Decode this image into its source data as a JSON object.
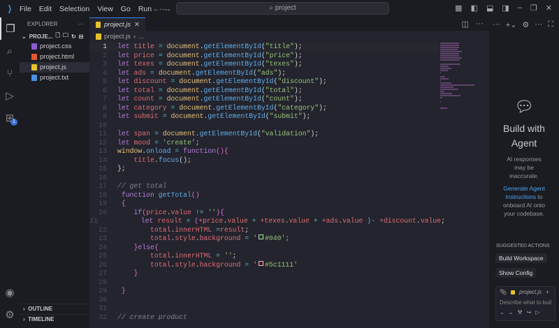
{
  "titlebar": {
    "menu": [
      "File",
      "Edit",
      "Selection",
      "View",
      "Go",
      "Run",
      "···"
    ],
    "search": "project"
  },
  "sidebar": {
    "title": "EXPLORER",
    "project": "PROJE...",
    "files": [
      {
        "name": "project.css",
        "color": "#8a5cd1"
      },
      {
        "name": "project.html",
        "color": "#e4572e"
      },
      {
        "name": "project.js",
        "color": "#e8c22b"
      },
      {
        "name": "project.txt",
        "color": "#4a8fe0"
      }
    ],
    "outline": "OUTLINE",
    "timeline": "TIMELINE",
    "extensions_badge": "1"
  },
  "editor": {
    "tab": "project.js",
    "breadcrumb": "project.js",
    "breadcrumb_more": "...",
    "current_line": 1,
    "lines": [
      [
        [
          "let ",
          "kw"
        ],
        [
          "title",
          "var"
        ],
        [
          " = ",
          "op"
        ],
        [
          "document",
          "obj"
        ],
        [
          ".",
          "p"
        ],
        [
          "getElementById",
          "fn"
        ],
        [
          "(",
          "p"
        ],
        [
          "\"title\"",
          "str"
        ],
        [
          ");",
          "p"
        ]
      ],
      [
        [
          "let ",
          "kw"
        ],
        [
          "price",
          "var"
        ],
        [
          " = ",
          "op"
        ],
        [
          "document",
          "obj"
        ],
        [
          ".",
          "p"
        ],
        [
          "getElementById",
          "fn"
        ],
        [
          "(",
          "p"
        ],
        [
          "\"price\"",
          "str"
        ],
        [
          ");",
          "p"
        ]
      ],
      [
        [
          "let ",
          "kw"
        ],
        [
          "texes",
          "var"
        ],
        [
          " = ",
          "op"
        ],
        [
          "document",
          "obj"
        ],
        [
          ".",
          "p"
        ],
        [
          "getElementById",
          "fn"
        ],
        [
          "(",
          "p"
        ],
        [
          "\"texes\"",
          "str"
        ],
        [
          ");",
          "p"
        ]
      ],
      [
        [
          "let ",
          "kw"
        ],
        [
          "ads",
          "var"
        ],
        [
          " = ",
          "op"
        ],
        [
          "document",
          "obj"
        ],
        [
          ".",
          "p"
        ],
        [
          "getElementById",
          "fn"
        ],
        [
          "(",
          "p"
        ],
        [
          "\"ads\"",
          "str"
        ],
        [
          ");",
          "p"
        ]
      ],
      [
        [
          "let ",
          "kw"
        ],
        [
          "discount",
          "var"
        ],
        [
          " = ",
          "op"
        ],
        [
          "document",
          "obj"
        ],
        [
          ".",
          "p"
        ],
        [
          "getElementById",
          "fn"
        ],
        [
          "(",
          "p"
        ],
        [
          "\"discount\"",
          "str"
        ],
        [
          ");",
          "p"
        ]
      ],
      [
        [
          "let ",
          "kw"
        ],
        [
          "total",
          "var"
        ],
        [
          " = ",
          "op"
        ],
        [
          "document",
          "obj"
        ],
        [
          ".",
          "p"
        ],
        [
          "getElementById",
          "fn"
        ],
        [
          "(",
          "p"
        ],
        [
          "\"total\"",
          "str"
        ],
        [
          ");",
          "p"
        ]
      ],
      [
        [
          "let ",
          "kw"
        ],
        [
          "count",
          "var"
        ],
        [
          " = ",
          "op"
        ],
        [
          "document",
          "obj"
        ],
        [
          ".",
          "p"
        ],
        [
          "getElementById",
          "fn"
        ],
        [
          "(",
          "p"
        ],
        [
          "\"count\"",
          "str"
        ],
        [
          ");",
          "p"
        ]
      ],
      [
        [
          "let ",
          "kw"
        ],
        [
          "category",
          "var"
        ],
        [
          " = ",
          "op"
        ],
        [
          "document",
          "obj"
        ],
        [
          ".",
          "p"
        ],
        [
          "getElementById",
          "fn"
        ],
        [
          "(",
          "p"
        ],
        [
          "\"category\"",
          "str"
        ],
        [
          ");",
          "p"
        ]
      ],
      [
        [
          "let ",
          "kw"
        ],
        [
          "submit",
          "var"
        ],
        [
          " = ",
          "op"
        ],
        [
          "document",
          "obj"
        ],
        [
          ".",
          "p"
        ],
        [
          "getElementById",
          "fn"
        ],
        [
          "(",
          "p"
        ],
        [
          "\"submit\"",
          "str"
        ],
        [
          ");",
          "p"
        ]
      ],
      [],
      [
        [
          "let ",
          "kw"
        ],
        [
          "span",
          "var"
        ],
        [
          " = ",
          "op"
        ],
        [
          "document",
          "obj"
        ],
        [
          ".",
          "p"
        ],
        [
          "getElementById",
          "fn"
        ],
        [
          "(",
          "p"
        ],
        [
          "\"validation\"",
          "str"
        ],
        [
          ");",
          "p"
        ]
      ],
      [
        [
          "let ",
          "kw"
        ],
        [
          "mood",
          "var"
        ],
        [
          " = ",
          "op"
        ],
        [
          "'create'",
          "str"
        ],
        [
          ";",
          "p"
        ]
      ],
      [
        [
          "window",
          "obj"
        ],
        [
          ".",
          "p"
        ],
        [
          "onload",
          "fn"
        ],
        [
          " = ",
          "op"
        ],
        [
          "function",
          "kw"
        ],
        [
          "(){",
          "br"
        ]
      ],
      [
        [
          "    title",
          "var"
        ],
        [
          ".",
          "p"
        ],
        [
          "focus",
          "fn"
        ],
        [
          "();",
          "p"
        ]
      ],
      [
        [
          "};",
          "p"
        ]
      ],
      [],
      [
        [
          "// get total",
          "com"
        ]
      ],
      [
        [
          " function ",
          "kw"
        ],
        [
          "getTotal",
          "fn"
        ],
        [
          "()",
          "br"
        ]
      ],
      [
        [
          " {",
          "br"
        ]
      ],
      [
        [
          "    if",
          "kw"
        ],
        [
          "(",
          "br"
        ],
        [
          "price",
          "var"
        ],
        [
          ".",
          "p"
        ],
        [
          "value",
          "var"
        ],
        [
          " != ",
          "op"
        ],
        [
          "''",
          "str"
        ],
        [
          "){",
          "br"
        ]
      ],
      [
        [
          "        let ",
          "kw"
        ],
        [
          "result",
          "var"
        ],
        [
          " = ",
          "op"
        ],
        [
          "(",
          "br"
        ],
        [
          "+price",
          "var"
        ],
        [
          ".",
          "p"
        ],
        [
          "value",
          "var"
        ],
        [
          " + ",
          "op"
        ],
        [
          "+texes",
          "var"
        ],
        [
          ".",
          "p"
        ],
        [
          "value",
          "var"
        ],
        [
          " + ",
          "op"
        ],
        [
          "+ads",
          "var"
        ],
        [
          ".",
          "p"
        ],
        [
          "value",
          "var"
        ],
        [
          " )- ",
          "op"
        ],
        [
          "+discount",
          "var"
        ],
        [
          ".",
          "p"
        ],
        [
          "value",
          "var"
        ],
        [
          ";",
          "p"
        ]
      ],
      [
        [
          "        total",
          "var"
        ],
        [
          ".",
          "p"
        ],
        [
          "innerHTML",
          "var"
        ],
        [
          " =",
          "op"
        ],
        [
          "result",
          "var"
        ],
        [
          ";",
          "p"
        ]
      ],
      [
        [
          "        total",
          "var"
        ],
        [
          ".",
          "p"
        ],
        [
          "style",
          "var"
        ],
        [
          ".",
          "p"
        ],
        [
          "background",
          "var"
        ],
        [
          " = ",
          "op"
        ],
        [
          "'",
          "str"
        ],
        [
          "#040",
          "swatch"
        ],
        [
          "#040';",
          "str"
        ]
      ],
      [
        [
          "    }",
          "br"
        ],
        [
          "else",
          "kw"
        ],
        [
          "{",
          "br"
        ]
      ],
      [
        [
          "        total",
          "var"
        ],
        [
          ".",
          "p"
        ],
        [
          "innerHTML",
          "var"
        ],
        [
          " = ",
          "op"
        ],
        [
          "''",
          "str"
        ],
        [
          ";",
          "p"
        ]
      ],
      [
        [
          "        total",
          "var"
        ],
        [
          ".",
          "p"
        ],
        [
          "style",
          "var"
        ],
        [
          ".",
          "p"
        ],
        [
          "background",
          "var"
        ],
        [
          " = ",
          "op"
        ],
        [
          "'",
          "str"
        ],
        [
          "#5c1111",
          "swatch"
        ],
        [
          "#5c1111'",
          "str"
        ]
      ],
      [
        [
          "    }",
          "br"
        ]
      ],
      [],
      [
        [
          " }",
          "br"
        ]
      ],
      [],
      [],
      [
        [
          "// create product",
          "com"
        ]
      ]
    ]
  },
  "agent": {
    "title": "Build with Agent",
    "note": "AI responses may be inaccurate.",
    "link": "Generate Agent Instructions",
    "link_rest": " to onboard AI onto your codebase.",
    "suggested": "SUGGESTED ACTIONS",
    "actions": [
      "Build Workspace",
      "Show Config"
    ],
    "context_file": "project.js",
    "placeholder": "Describe what to build"
  }
}
